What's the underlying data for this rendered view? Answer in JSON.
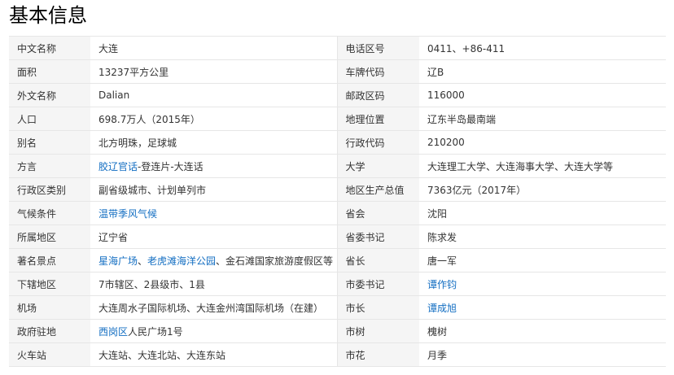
{
  "title": "基本信息",
  "colors": {
    "link": "#136ec2",
    "key_bg": "#f5f5f5",
    "border": "#e6e6e6"
  },
  "rows": [
    {
      "left": {
        "label": "中文名称",
        "value": [
          {
            "text": "大连"
          }
        ]
      },
      "right": {
        "label": "电话区号",
        "value": [
          {
            "text": "0411、+86-411"
          }
        ]
      }
    },
    {
      "left": {
        "label": "面积",
        "value": [
          {
            "text": "13237平方公里"
          }
        ]
      },
      "right": {
        "label": "车牌代码",
        "value": [
          {
            "text": "辽B"
          }
        ]
      }
    },
    {
      "left": {
        "label": "外文名称",
        "value": [
          {
            "text": "Dalian"
          }
        ]
      },
      "right": {
        "label": "邮政区码",
        "value": [
          {
            "text": "116000"
          }
        ]
      }
    },
    {
      "left": {
        "label": "人口",
        "value": [
          {
            "text": "698.7万人（2015年）"
          }
        ]
      },
      "right": {
        "label": "地理位置",
        "value": [
          {
            "text": "辽东半岛最南端"
          }
        ]
      }
    },
    {
      "left": {
        "label": "别名",
        "value": [
          {
            "text": "北方明珠，足球城"
          }
        ]
      },
      "right": {
        "label": "行政代码",
        "value": [
          {
            "text": "210200"
          }
        ]
      }
    },
    {
      "left": {
        "label": "方言",
        "value": [
          {
            "text": "胶辽官话",
            "link": true
          },
          {
            "text": "-登连片-大连话"
          }
        ]
      },
      "right": {
        "label": "大学",
        "value": [
          {
            "text": "大连理工大学、大连海事大学、大连大学等"
          }
        ]
      }
    },
    {
      "left": {
        "label": "行政区类别",
        "value": [
          {
            "text": "副省级城市、计划单列市"
          }
        ]
      },
      "right": {
        "label": "地区生产总值",
        "value": [
          {
            "text": "7363亿元（2017年）"
          }
        ]
      }
    },
    {
      "left": {
        "label": "气候条件",
        "value": [
          {
            "text": "温带季风气候",
            "link": true
          }
        ]
      },
      "right": {
        "label": "省会",
        "value": [
          {
            "text": "沈阳"
          }
        ]
      }
    },
    {
      "left": {
        "label": "所属地区",
        "value": [
          {
            "text": "辽宁省"
          }
        ]
      },
      "right": {
        "label": "省委书记",
        "value": [
          {
            "text": "陈求发"
          }
        ]
      }
    },
    {
      "left": {
        "label": "著名景点",
        "value": [
          {
            "text": "星海广场",
            "link": true
          },
          {
            "text": "、"
          },
          {
            "text": "老虎滩海洋公园",
            "link": true
          },
          {
            "text": "、金石滩国家旅游度假区等"
          }
        ]
      },
      "right": {
        "label": "省长",
        "value": [
          {
            "text": "唐一军"
          }
        ]
      }
    },
    {
      "left": {
        "label": "下辖地区",
        "value": [
          {
            "text": "7市辖区、2县级市、1县"
          }
        ]
      },
      "right": {
        "label": "市委书记",
        "value": [
          {
            "text": "谭作钧",
            "link": true
          }
        ]
      }
    },
    {
      "left": {
        "label": "机场",
        "value": [
          {
            "text": "大连周水子国际机场、大连金州湾国际机场（在建）"
          }
        ]
      },
      "right": {
        "label": "市长",
        "value": [
          {
            "text": "谭成旭",
            "link": true
          }
        ]
      }
    },
    {
      "left": {
        "label": "政府驻地",
        "value": [
          {
            "text": "西岗区",
            "link": true
          },
          {
            "text": "人民广场1号"
          }
        ]
      },
      "right": {
        "label": "市树",
        "value": [
          {
            "text": "槐树"
          }
        ]
      }
    },
    {
      "left": {
        "label": "火车站",
        "value": [
          {
            "text": "大连站、大连北站、大连东站"
          }
        ]
      },
      "right": {
        "label": "市花",
        "value": [
          {
            "text": "月季"
          }
        ]
      }
    }
  ]
}
